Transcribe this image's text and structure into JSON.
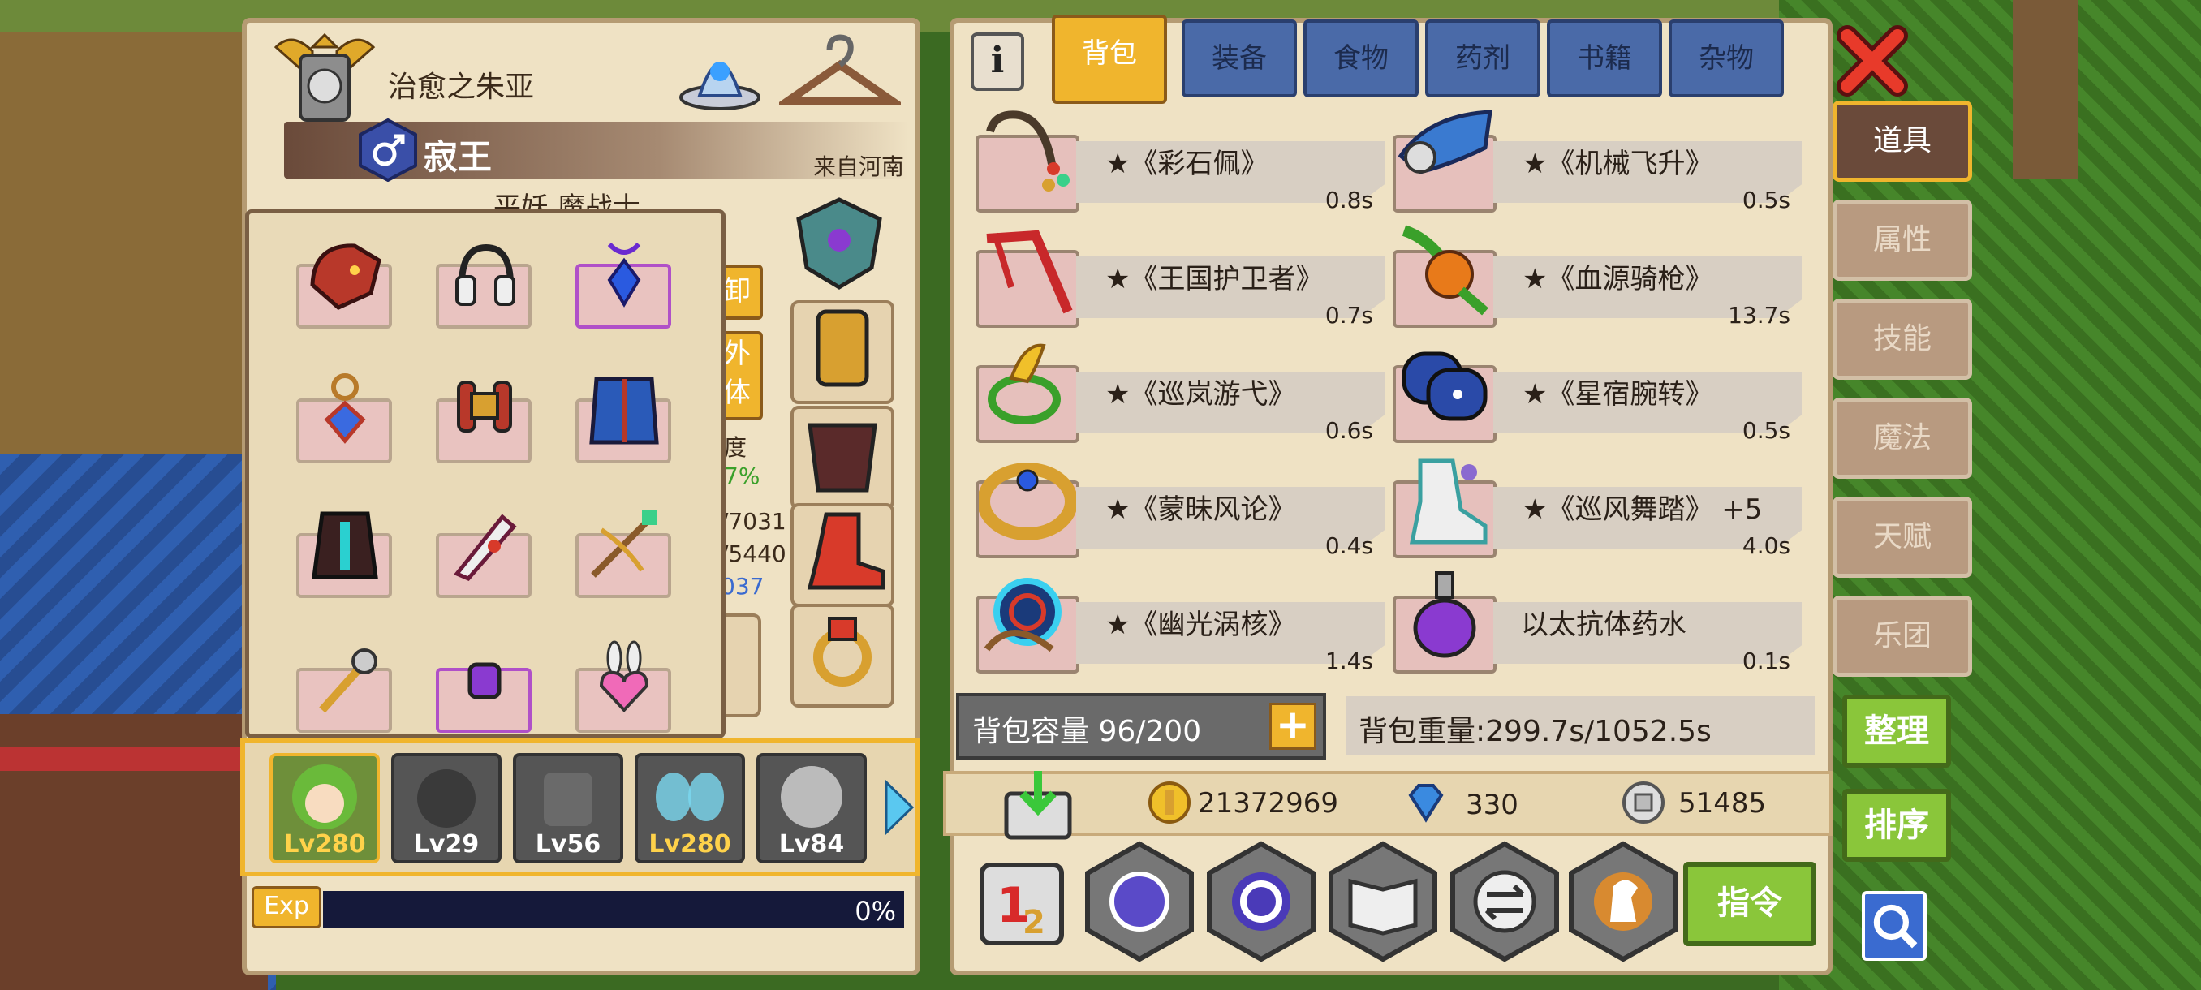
{
  "character": {
    "name": "治愈之朱亚",
    "title": "寂王",
    "origin": "来自河南",
    "race_partial": "平妖 魔战士",
    "unload_partial": "卸",
    "appearance_partial_1": "外",
    "appearance_partial_2": "体",
    "stat_label_partial": "度",
    "stat_pct_partial": "7%",
    "stat_hp_partial": "/7031",
    "stat_mp_partial": "/5440",
    "stat_val_partial": "037"
  },
  "party": [
    {
      "level": "Lv280",
      "active": true
    },
    {
      "level": "Lv29",
      "active": false
    },
    {
      "level": "Lv56",
      "active": false
    },
    {
      "level": "Lv280",
      "active": false
    },
    {
      "level": "Lv84",
      "active": false
    }
  ],
  "exp": {
    "label": "Exp",
    "value": "0%",
    "fill": 0
  },
  "tabs": [
    "背包",
    "装备",
    "食物",
    "药剂",
    "书籍",
    "杂物"
  ],
  "items": [
    {
      "name": "★《彩石佩》",
      "time": "0.8s"
    },
    {
      "name": "★《机械飞升》",
      "time": "0.5s"
    },
    {
      "name": "★《王国护卫者》",
      "time": "0.7s"
    },
    {
      "name": "★《血源骑枪》",
      "time": "13.7s"
    },
    {
      "name": "★《巡岚游弋》",
      "time": "0.6s"
    },
    {
      "name": "★《星宿腕转》",
      "time": "0.5s"
    },
    {
      "name": "★《蒙昧风论》",
      "time": "0.4s"
    },
    {
      "name": "★《巡风舞踏》 +5",
      "time": "4.0s"
    },
    {
      "name": "★《幽光涡核》",
      "time": "1.4s"
    },
    {
      "name": "以太抗体药水",
      "time": "0.1s"
    }
  ],
  "capacity": {
    "label": "背包容量 96/200"
  },
  "weight": {
    "label": "背包重量:299.7s/1052.5s"
  },
  "currency": {
    "gold": "21372969",
    "gem": "330",
    "silver": "51485"
  },
  "actions": {
    "command": "指令"
  },
  "side_tabs": [
    "道具",
    "属性",
    "技能",
    "魔法",
    "天赋",
    "乐团"
  ],
  "side_buttons": {
    "sort_tidy": "整理",
    "sort_order": "排序"
  },
  "colors": {
    "accent": "#f0b52d",
    "tab_blue": "#4a6aa8",
    "panel": "#efe2c4",
    "green": "#8ac63a"
  }
}
